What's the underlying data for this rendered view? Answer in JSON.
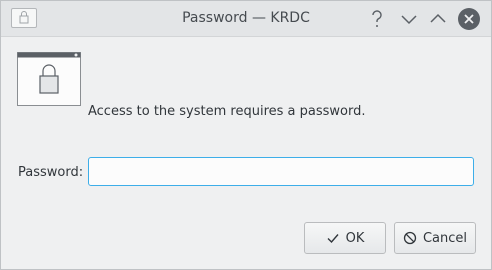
{
  "window": {
    "title": "Password — KRDC"
  },
  "titlebar": {
    "app_icon": "lock-window-icon",
    "buttons": [
      {
        "name": "help",
        "icon": "question-icon"
      },
      {
        "name": "minimize",
        "icon": "chevron-down-icon"
      },
      {
        "name": "maximize",
        "icon": "chevron-up-icon"
      },
      {
        "name": "close",
        "icon": "close-icon"
      }
    ]
  },
  "dialog": {
    "icon": "password-lock-icon",
    "message": "Access to the system requires a password.",
    "password_label": "Password:",
    "password_value": "",
    "password_placeholder": ""
  },
  "buttons": {
    "ok_label": "OK",
    "ok_icon": "checkmark-icon",
    "cancel_label": "Cancel",
    "cancel_icon": "cancel-circle-icon"
  },
  "colors": {
    "accent": "#3daee9",
    "window_bg": "#eff0f1",
    "text": "#31363b"
  }
}
